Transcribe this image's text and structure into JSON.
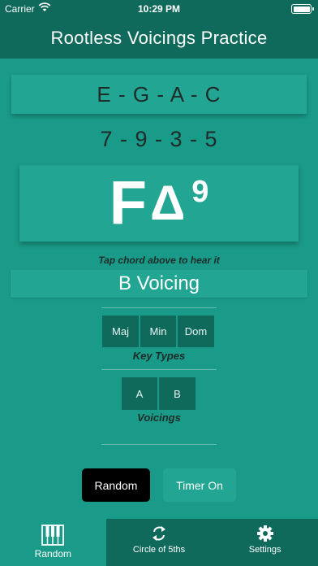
{
  "status_bar": {
    "carrier": "Carrier",
    "time": "10:29 PM"
  },
  "nav": {
    "title": "Rootless Voicings Practice"
  },
  "notes": "E - G - A - C",
  "intervals": "7 - 9 - 3 - 5",
  "chord": {
    "root": "F",
    "quality": "Δ",
    "extension": "9"
  },
  "hint": "Tap chord above to hear it",
  "voicing": "B Voicing",
  "key_types": {
    "label": "Key Types",
    "options": [
      "Maj",
      "Min",
      "Dom"
    ]
  },
  "voicings": {
    "label": "Voicings",
    "options": [
      "A",
      "B"
    ]
  },
  "buttons": {
    "random": "Random",
    "timer": "Timer On"
  },
  "tabs": [
    {
      "label": "Random",
      "icon": "piano-icon",
      "active": true
    },
    {
      "label": "Circle of 5ths",
      "icon": "refresh-icon",
      "active": false
    },
    {
      "label": "Settings",
      "icon": "gear-icon",
      "active": false
    }
  ],
  "colors": {
    "background": "#1a9a88",
    "dark": "#0f6a5c",
    "card": "#22a693",
    "primary_button": "#000000"
  }
}
